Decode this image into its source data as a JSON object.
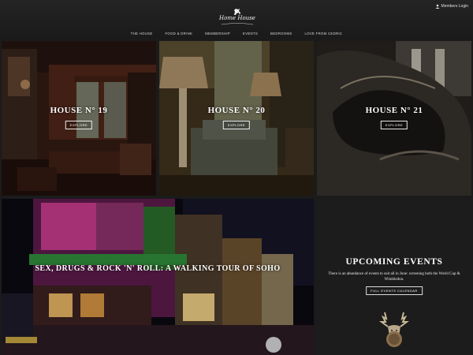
{
  "header": {
    "logo_text": "Home House",
    "members_login": "Members Login",
    "nav": [
      "THE HOUSE",
      "FOOD & DRINK",
      "MEMBERSHIP",
      "EVENTS",
      "BEDROOMS",
      "LOVE FROM CEDRIC"
    ]
  },
  "tiles": [
    {
      "title": "HOUSE N° 19",
      "button": "EXPLORE"
    },
    {
      "title": "HOUSE N° 20",
      "button": "EXPLORE"
    },
    {
      "title": "HOUSE N° 21",
      "button": "EXPLORE"
    }
  ],
  "feature": {
    "title": "SEX, DRUGS & ROCK 'N' ROLL: A WALKING TOUR OF SOHO"
  },
  "events": {
    "title": "UPCOMING EVENTS",
    "text": "There is an abundance of events to suit all in June: screening both the World Cup & Wimbledon.",
    "button": "FULL EVENTS CALENDAR"
  },
  "colors": {
    "background": "#1b1b1b",
    "text": "#ffffff"
  },
  "icons": {
    "members": "person-icon",
    "logo": "horse-icon",
    "stag": "stag-head-icon"
  }
}
